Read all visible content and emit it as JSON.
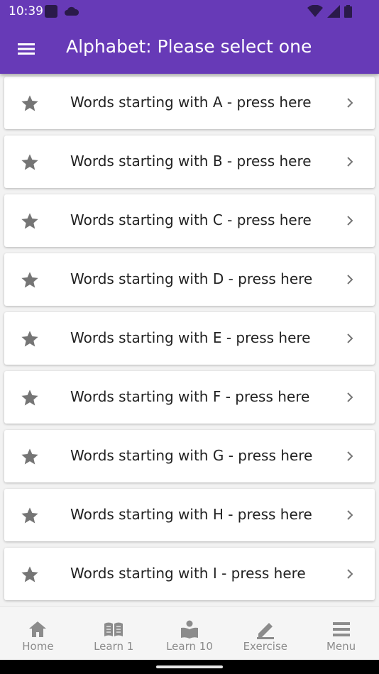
{
  "status_bar": {
    "time": "10:39",
    "left_icons": [
      "app-notification-icon",
      "cloud-icon"
    ],
    "right_icons": [
      "wifi-icon",
      "signal-icon",
      "battery-icon"
    ]
  },
  "app_bar": {
    "title": "Alphabet: Please select one",
    "menu_icon": "hamburger-menu-icon"
  },
  "list": {
    "items": [
      {
        "label": "Words starting with A - press here"
      },
      {
        "label": "Words starting with B - press here"
      },
      {
        "label": "Words starting with C - press here"
      },
      {
        "label": "Words starting with D - press here"
      },
      {
        "label": "Words starting with E - press here"
      },
      {
        "label": "Words starting with F - press here"
      },
      {
        "label": "Words starting with G - press here"
      },
      {
        "label": "Words starting with H - press here"
      },
      {
        "label": "Words starting with I - press here"
      }
    ]
  },
  "bottom_nav": {
    "items": [
      {
        "label": "Home",
        "icon": "home-icon"
      },
      {
        "label": "Learn 1",
        "icon": "book-icon"
      },
      {
        "label": "Learn 10",
        "icon": "reader-icon"
      },
      {
        "label": "Exercise",
        "icon": "pencil-icon"
      },
      {
        "label": "Menu",
        "icon": "menu-icon"
      }
    ]
  },
  "colors": {
    "primary": "#673ab7",
    "icon_gray": "#8c8c8c",
    "background": "#f2f2f2"
  }
}
